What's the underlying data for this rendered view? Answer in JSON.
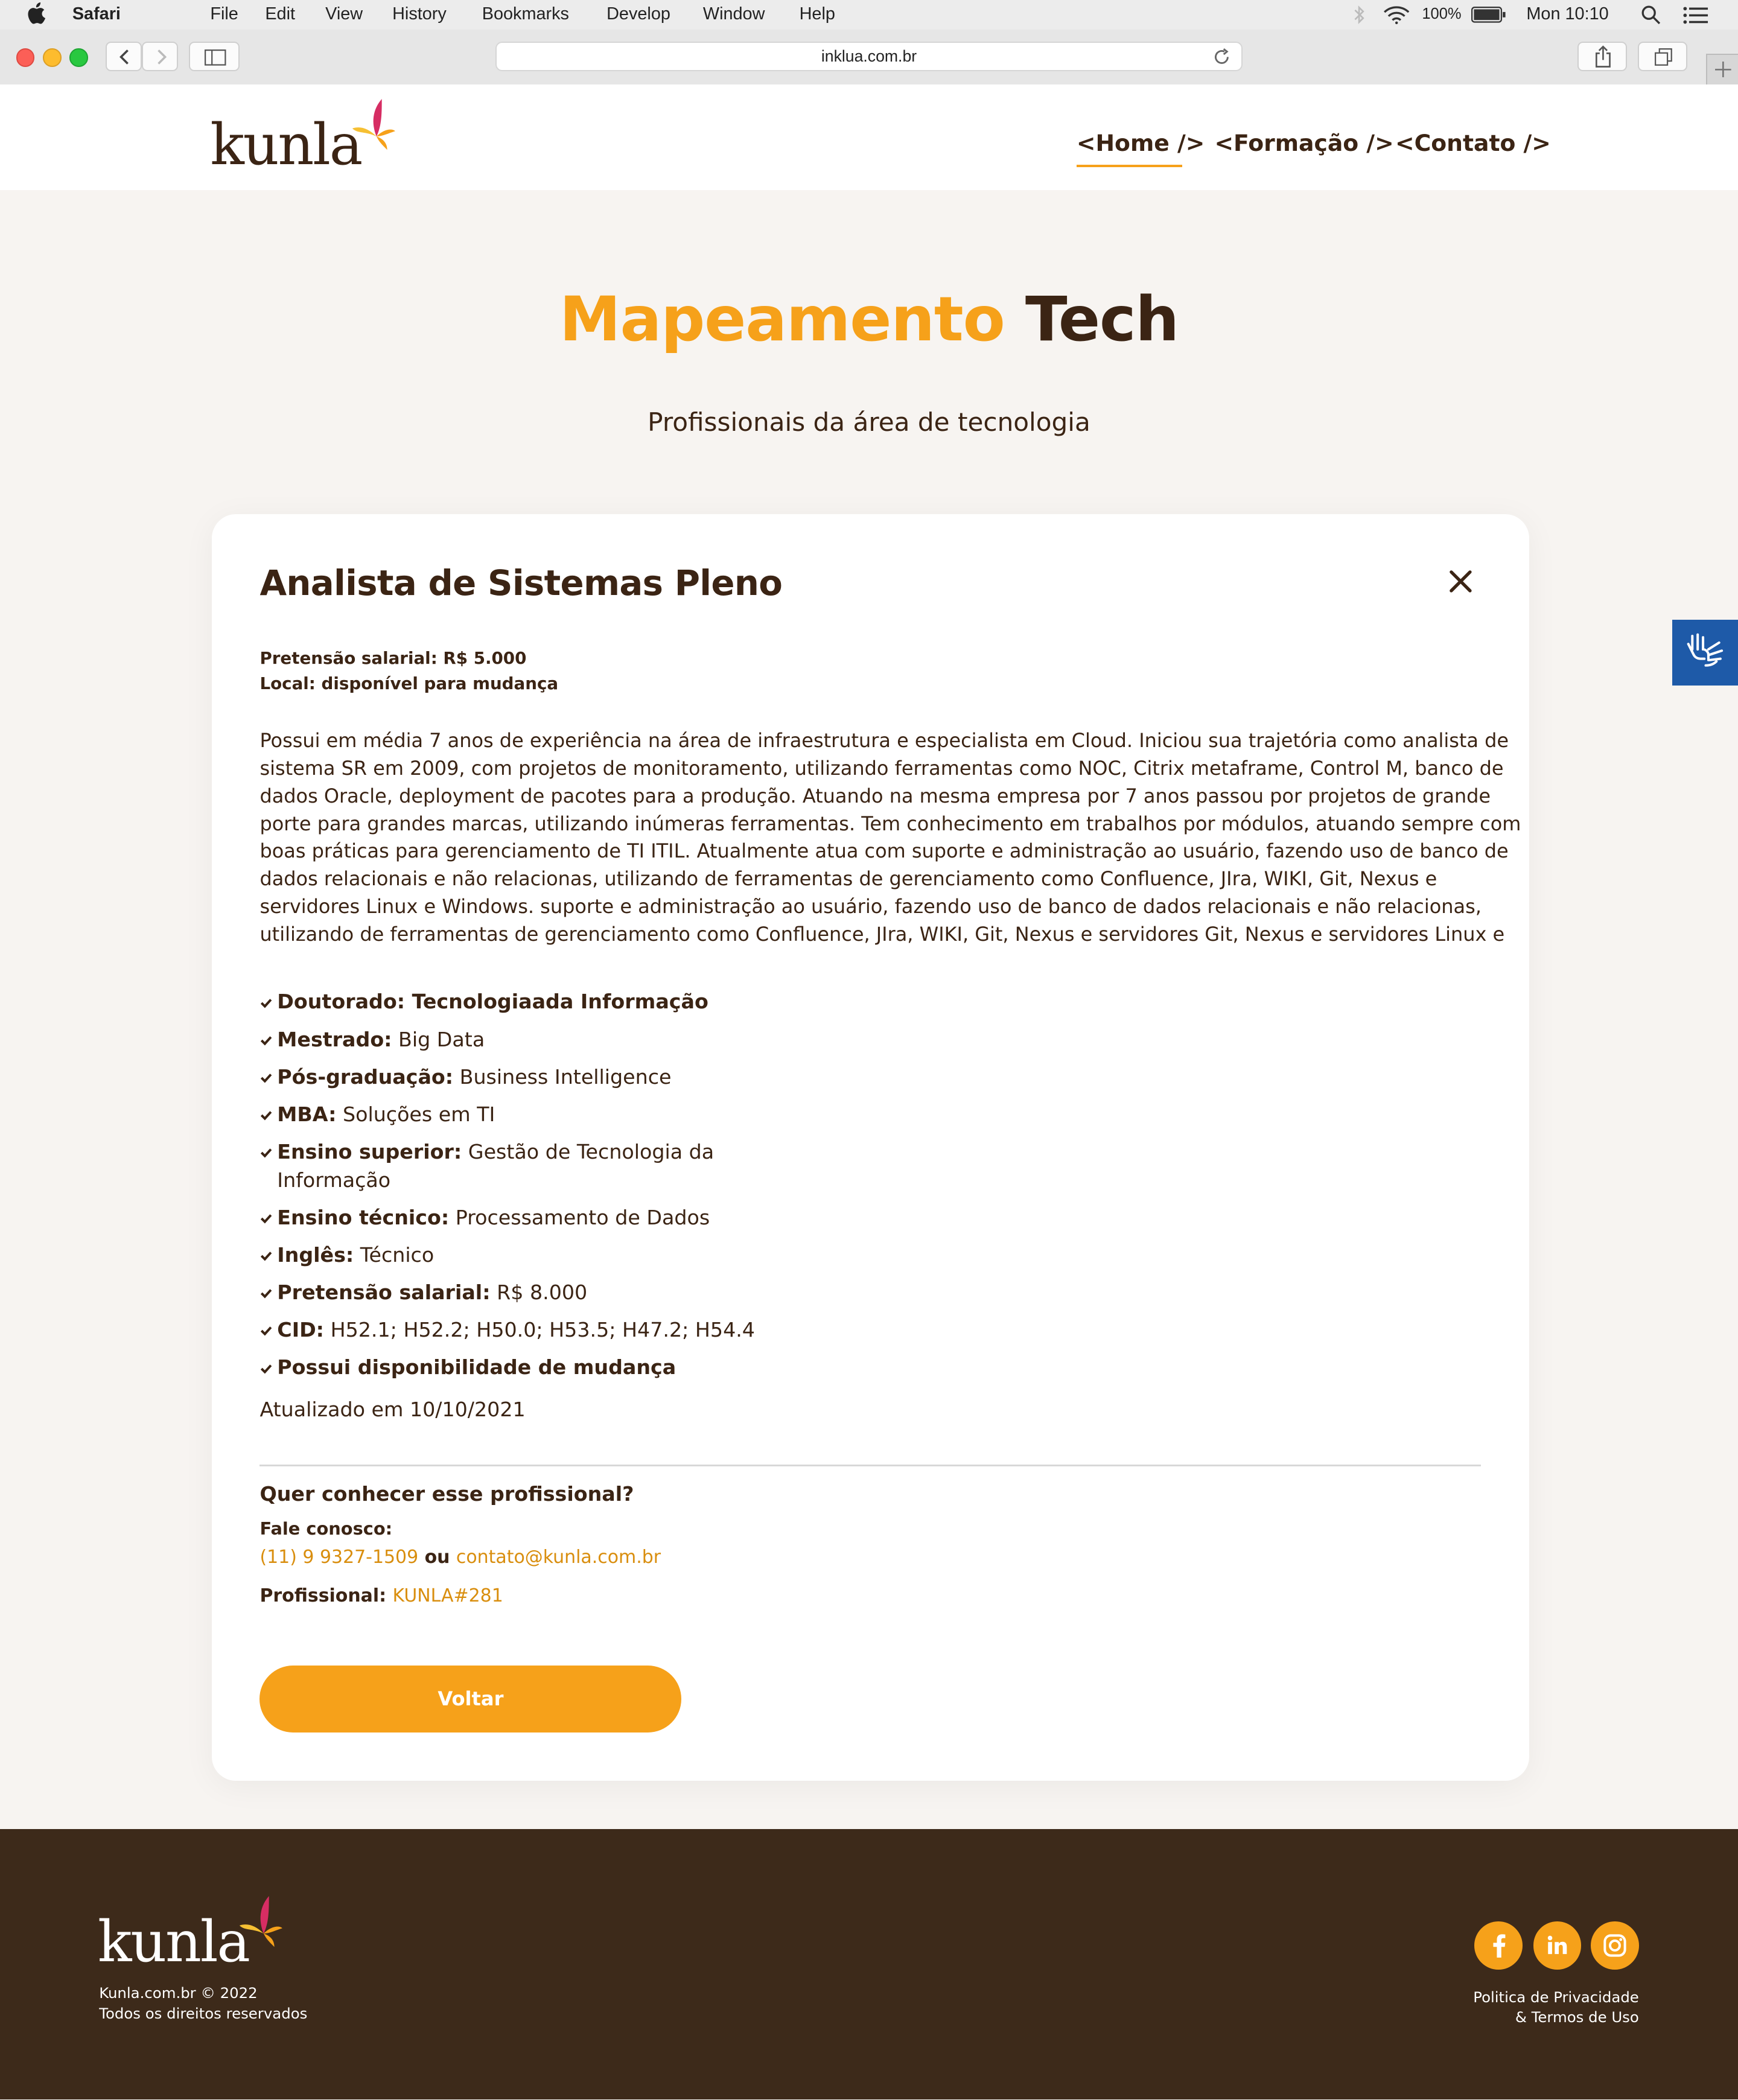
{
  "menubar": {
    "app": "Safari",
    "items": [
      "File",
      "Edit",
      "View",
      "History",
      "Bookmarks",
      "Develop",
      "Window",
      "Help"
    ],
    "battery": "100%",
    "clock": "Mon 10:10"
  },
  "browser": {
    "url": "inklua.com.br"
  },
  "site": {
    "logo": "kunla",
    "nav": [
      "<Home />",
      "<Formação />",
      "<Contato />"
    ]
  },
  "hero": {
    "title_orange": "Mapeamento",
    "title_dark": "Tech",
    "subtitle": "Profissionais da área de tecnologia"
  },
  "profile": {
    "title": "Analista de Sistemas Pleno",
    "salary_line": "Pretensão salarial: R$ 5.000",
    "location_line": "Local: disponível para mudança",
    "description_lines": [
      "Possui em média 7 anos de experiência na área de infraestrutura e especialista em Cloud. Iniciou sua trajetória como analista de",
      "sistema SR em 2009, com projetos de monitoramento, utilizando ferramentas como NOC, Citrix metaframe, Control M, banco de",
      "dados Oracle, deployment de pacotes para a produção. Atuando na mesma empresa por 7 anos passou por projetos de grande",
      "porte para grandes marcas, utilizando inúmeras ferramentas. Tem conhecimento em trabalhos por módulos, atuando sempre com",
      "boas práticas para gerenciamento de TI ITIL.  Atualmente atua com suporte e administração ao usuário, fazendo uso de banco de",
      "dados relacionais e não relacionas, utilizando de ferramentas de gerenciamento como Confluence, JIra, WIKI, Git, Nexus e",
      "servidores Linux e Windows. suporte e administração ao usuário, fazendo uso de banco de dados relacionais e não relacionas,",
      "utilizando de ferramentas de gerenciamento como Confluence, JIra, WIKI, Git, Nexus e servidores Git, Nexus e servidores Linux e"
    ],
    "checklist": [
      {
        "label": "Doutorado: Tecnologiaada Informação",
        "value": ""
      },
      {
        "label": "Mestrado:",
        "value": " Big Data"
      },
      {
        "label": "Pós-graduação:",
        "value": " Business Intelligence"
      },
      {
        "label": "MBA:",
        "value": " Soluções em TI"
      },
      {
        "label": "Ensino superior:",
        "value": " Gestão de Tecnologia da",
        "value2": "Informação"
      },
      {
        "label": "Ensino técnico:",
        "value": " Processamento de Dados"
      },
      {
        "label": "Inglês:",
        "value": " Técnico"
      },
      {
        "label": "Pretensão salarial:",
        "value": " R$ 8.000"
      },
      {
        "label": "CID:",
        "value": " H52.1; H52.2; H50.0; H53.5; H47.2; H54.4"
      },
      {
        "label": "Possui disponibilidade de mudança",
        "value": ""
      }
    ],
    "updated": "Atualizado em 10/10/2021",
    "cta_question": "Quer conhecer esse profissional?",
    "fale": "Fale conosco:",
    "phone": "(11) 9 9327-1509",
    "ou": " ou ",
    "email": "contato@kunla.com.br",
    "prof_label": "Profissional: ",
    "prof_code": "KUNLA#281",
    "back_button": "Voltar"
  },
  "footer": {
    "logo": "kunla",
    "copyright": "Kunla.com.br © 2022",
    "rights": "Todos os direitos reservados",
    "legal1": "Politica de Privacidade",
    "legal2": "& Termos de Uso",
    "social": [
      "facebook-icon",
      "linkedin-icon",
      "instagram-icon"
    ]
  },
  "colors": {
    "accent": "#f6a11a",
    "brown": "#3b2414",
    "footer": "#3d2a1a",
    "access": "#1e5aa8"
  }
}
